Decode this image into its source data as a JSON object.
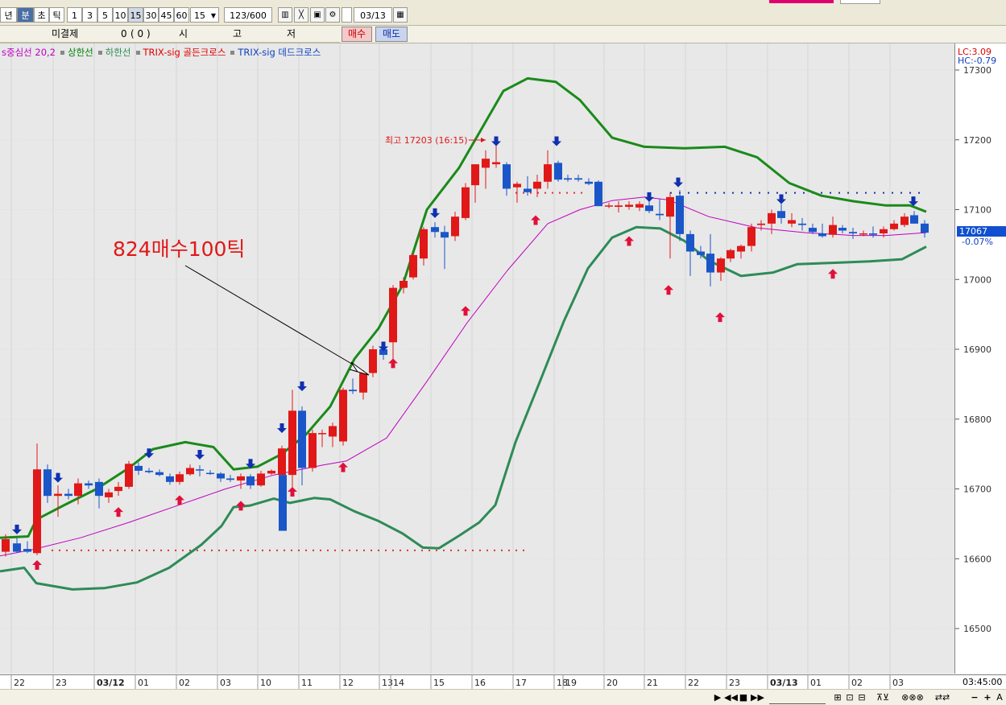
{
  "toolbar": {
    "period_buttons": [
      "년",
      "분",
      "초",
      "틱"
    ],
    "interval_buttons": [
      "1",
      "3",
      "5",
      "10",
      "15",
      "30",
      "45",
      "60"
    ],
    "interval_value": "15",
    "count_value": "123/600",
    "date_value": "03/13"
  },
  "infobar": {
    "unsettled_label": "미결제",
    "unsettled_value": "0",
    "unsettled_change": "( 0 )",
    "open_label": "시",
    "high_label": "고",
    "low_label": "저",
    "buy_label": "매수",
    "sell_label": "매도"
  },
  "legend": {
    "items": [
      {
        "label": "s중심선 20,2",
        "color": "#c000c0"
      },
      {
        "label": "상한선",
        "color": "#008000"
      },
      {
        "label": "하한선",
        "color": "#2e8b57"
      },
      {
        "label": "TRIX-sig 골든크로스",
        "color": "#e00000"
      },
      {
        "label": "TRIX-sig 데드크로스",
        "color": "#1040c0"
      }
    ]
  },
  "yaxis": {
    "lc": "LC:3.09",
    "hc": "HC:-0.79",
    "current_price": "17067",
    "current_change": "-0.07%",
    "ticks": [
      "17300",
      "17200",
      "17100",
      "17000",
      "16900",
      "16800",
      "16700",
      "16600",
      "16500"
    ]
  },
  "xaxis": {
    "labels": [
      "22",
      "23",
      "03/12",
      "01",
      "02",
      "03",
      "10",
      "11",
      "12",
      "13",
      "14",
      "15",
      "16",
      "17",
      "18",
      "19",
      "20",
      "21",
      "22",
      "23",
      "03/13",
      "01",
      "02",
      "03"
    ],
    "end_time": "03:45:00"
  },
  "annotations": {
    "big_text": "824매수100틱",
    "high_label": "최고 17203 (16:15)"
  },
  "chart_data": {
    "type": "candlestick",
    "ylim": [
      16430,
      17310
    ],
    "price_ticks": [
      17300,
      17200,
      17100,
      17000,
      16900,
      16800,
      16700,
      16600,
      16500
    ],
    "x_labels": [
      "22",
      "23",
      "03/12",
      "01",
      "02",
      "03",
      "10",
      "11",
      "12",
      "13",
      "14",
      "15",
      "16",
      "17",
      "18",
      "19",
      "20",
      "21",
      "22",
      "23",
      "03/13",
      "01",
      "02",
      "03"
    ],
    "annotation": "824매수100틱",
    "high_marker": "최고 17203 (16:15)",
    "series": [
      {
        "name": "s중심선 20,2",
        "type": "line",
        "color": "#c000c0",
        "points": [
          [
            0,
            16604
          ],
          [
            40,
            16613
          ],
          [
            100,
            16630
          ],
          [
            160,
            16652
          ],
          [
            220,
            16676
          ],
          [
            280,
            16700
          ],
          [
            340,
            16720
          ],
          [
            400,
            16734
          ],
          [
            430,
            16740
          ],
          [
            480,
            16773
          ],
          [
            530,
            16854
          ],
          [
            580,
            16938
          ],
          [
            630,
            17013
          ],
          [
            680,
            17080
          ],
          [
            720,
            17100
          ],
          [
            760,
            17113
          ],
          [
            800,
            17118
          ],
          [
            830,
            17114
          ],
          [
            880,
            17090
          ],
          [
            940,
            17074
          ],
          [
            1000,
            17067
          ],
          [
            1060,
            17063
          ],
          [
            1100,
            17063
          ],
          [
            1150,
            17067
          ]
        ]
      },
      {
        "name": "상한선",
        "type": "line",
        "color": "#1a8a1a",
        "points": [
          [
            0,
            16630
          ],
          [
            35,
            16632
          ],
          [
            45,
            16656
          ],
          [
            80,
            16677
          ],
          [
            120,
            16700
          ],
          [
            160,
            16730
          ],
          [
            190,
            16757
          ],
          [
            230,
            16767
          ],
          [
            265,
            16760
          ],
          [
            290,
            16728
          ],
          [
            320,
            16732
          ],
          [
            350,
            16750
          ],
          [
            380,
            16778
          ],
          [
            410,
            16818
          ],
          [
            440,
            16886
          ],
          [
            470,
            16930
          ],
          [
            500,
            16992
          ],
          [
            530,
            17100
          ],
          [
            570,
            17160
          ],
          [
            600,
            17220
          ],
          [
            625,
            17270
          ],
          [
            655,
            17288
          ],
          [
            690,
            17283
          ],
          [
            720,
            17257
          ],
          [
            760,
            17203
          ],
          [
            800,
            17190
          ],
          [
            850,
            17188
          ],
          [
            900,
            17190
          ],
          [
            940,
            17175
          ],
          [
            980,
            17138
          ],
          [
            1020,
            17120
          ],
          [
            1060,
            17112
          ],
          [
            1100,
            17106
          ],
          [
            1130,
            17106
          ],
          [
            1150,
            17097
          ]
        ]
      },
      {
        "name": "하한선",
        "type": "line",
        "color": "#2e8b57",
        "points": [
          [
            0,
            16582
          ],
          [
            30,
            16587
          ],
          [
            45,
            16565
          ],
          [
            90,
            16556
          ],
          [
            130,
            16558
          ],
          [
            170,
            16566
          ],
          [
            210,
            16587
          ],
          [
            250,
            16620
          ],
          [
            275,
            16647
          ],
          [
            290,
            16674
          ],
          [
            310,
            16676
          ],
          [
            340,
            16686
          ],
          [
            360,
            16680
          ],
          [
            390,
            16687
          ],
          [
            410,
            16685
          ],
          [
            440,
            16668
          ],
          [
            470,
            16654
          ],
          [
            500,
            16636
          ],
          [
            525,
            16616
          ],
          [
            545,
            16615
          ],
          [
            570,
            16633
          ],
          [
            595,
            16652
          ],
          [
            615,
            16677
          ],
          [
            640,
            16767
          ],
          [
            670,
            16853
          ],
          [
            700,
            16940
          ],
          [
            730,
            17016
          ],
          [
            760,
            17060
          ],
          [
            790,
            17075
          ],
          [
            820,
            17073
          ],
          [
            850,
            17055
          ],
          [
            880,
            17027
          ],
          [
            920,
            17005
          ],
          [
            960,
            17010
          ],
          [
            990,
            17022
          ],
          [
            1040,
            17024
          ],
          [
            1080,
            17026
          ],
          [
            1120,
            17029
          ],
          [
            1150,
            17047
          ]
        ]
      }
    ]
  }
}
